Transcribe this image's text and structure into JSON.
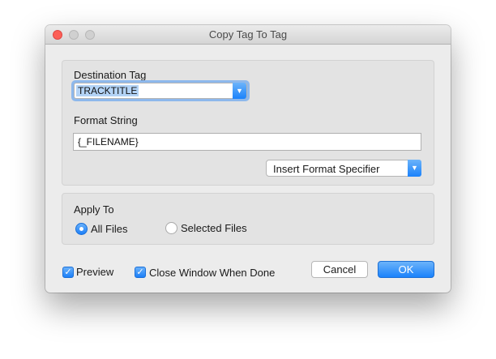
{
  "window": {
    "title": "Copy Tag To Tag"
  },
  "destination": {
    "label": "Destination Tag",
    "selected": "TRACKTITLE"
  },
  "format": {
    "label": "Format String",
    "value": "{_FILENAME}",
    "insert_button": "Insert Format Specifier"
  },
  "apply_to": {
    "label": "Apply To",
    "options": [
      {
        "label": "All Files",
        "selected": true
      },
      {
        "label": "Selected Files",
        "selected": false
      }
    ]
  },
  "options": {
    "preview": {
      "label": "Preview",
      "checked": true
    },
    "close_when_done": {
      "label": "Close Window When Done",
      "checked": true
    }
  },
  "buttons": {
    "cancel": "Cancel",
    "ok": "OK"
  },
  "colors": {
    "accent": "#1a82fb",
    "close": "#fc5f57",
    "selection": "#b3d3f6"
  },
  "icons": {
    "dropdown": "chevron-down-icon",
    "check": "checkmark-icon"
  }
}
